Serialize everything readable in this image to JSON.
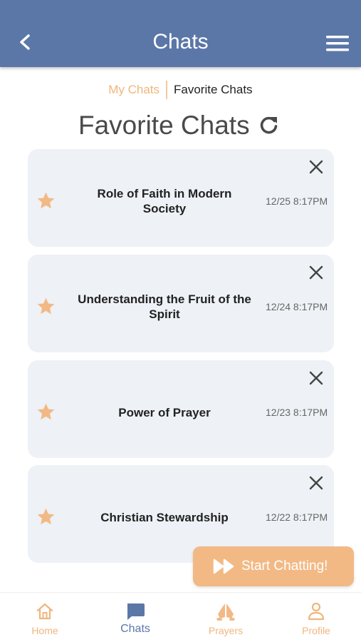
{
  "header": {
    "title": "Chats",
    "back_icon": "chevron-left-icon",
    "menu_icon": "hamburger-menu-icon"
  },
  "segment": {
    "my_chats": "My Chats",
    "favorite_chats": "Favorite Chats"
  },
  "page": {
    "title": "Favorite Chats",
    "refresh_icon": "refresh-icon"
  },
  "chats": [
    {
      "title": "Role of Faith in Modern Society",
      "time": "12/25 8:17PM"
    },
    {
      "title": "Understanding the Fruit of the Spirit",
      "time": "12/24 8:17PM"
    },
    {
      "title": "Power of Prayer",
      "time": "12/23 8:17PM"
    },
    {
      "title": "Christian Stewardship",
      "time": "12/22 8:17PM"
    }
  ],
  "start_button": {
    "label": "Start Chatting!",
    "icon": "fast-forward-icon"
  },
  "tabs": [
    {
      "label": "Home",
      "icon": "home-icon"
    },
    {
      "label": "Chats",
      "icon": "chat-bubble-icon"
    },
    {
      "label": "Prayers",
      "icon": "praying-hands-icon"
    },
    {
      "label": "Profile",
      "icon": "user-icon"
    }
  ],
  "colors": {
    "header": "#5b77a8",
    "accent": "#f0b57c",
    "card": "#eef1f5",
    "button": "#f2b985"
  }
}
